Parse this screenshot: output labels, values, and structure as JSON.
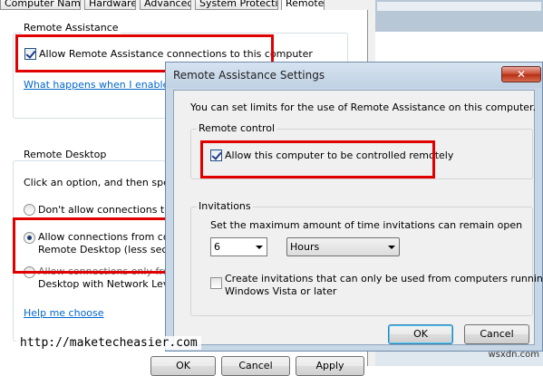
{
  "system_properties": {
    "tabs": [
      "Computer Name",
      "Hardware",
      "Advanced",
      "System Protection",
      "Remote"
    ],
    "remote_assistance": {
      "group_title": "Remote Assistance",
      "allow_checkbox_label": "Allow Remote Assistance connections to this computer",
      "allow_checked": true,
      "help_link": "What happens when I enable Re"
    },
    "remote_desktop": {
      "group_title": "Remote Desktop",
      "instruction": "Click an option, and then specify",
      "option_dont_allow": "Don't allow connections to thi",
      "option_allow_any_line1": "Allow connections from comp",
      "option_allow_any_line2": "Remote Desktop (less secure",
      "option_nla_line1": "Allow connections only from c",
      "option_nla_line2": "Desktop with Network Level A",
      "selected_option": "option_allow_any",
      "help_link": "Help me choose"
    },
    "buttons": {
      "ok": "OK",
      "cancel": "Cancel",
      "apply": "Apply"
    }
  },
  "dialog": {
    "title": "Remote Assistance Settings",
    "close_glyph": "✕",
    "intro": "You can set limits for the use of Remote Assistance on this computer.",
    "remote_control": {
      "group_title": "Remote control",
      "allow_control_label": "Allow this computer to be controlled remotely",
      "allow_control_checked": true
    },
    "invitations": {
      "group_title": "Invitations",
      "max_time_label": "Set the maximum amount of time invitations can remain open",
      "amount_value": "6",
      "unit_value": "Hours",
      "vista_label_line1": "Create invitations that can only be used from computers running",
      "vista_label_line2": "Windows Vista or later",
      "vista_checked": false
    },
    "buttons": {
      "ok": "OK",
      "cancel": "Cancel"
    }
  },
  "watermark": "http://maketecheasier.com",
  "corner_mark": "wsxdn.com",
  "colors": {
    "highlight_box": "#e00000",
    "link": "#0066cc",
    "dialog_frame": "#c8d7e6"
  }
}
